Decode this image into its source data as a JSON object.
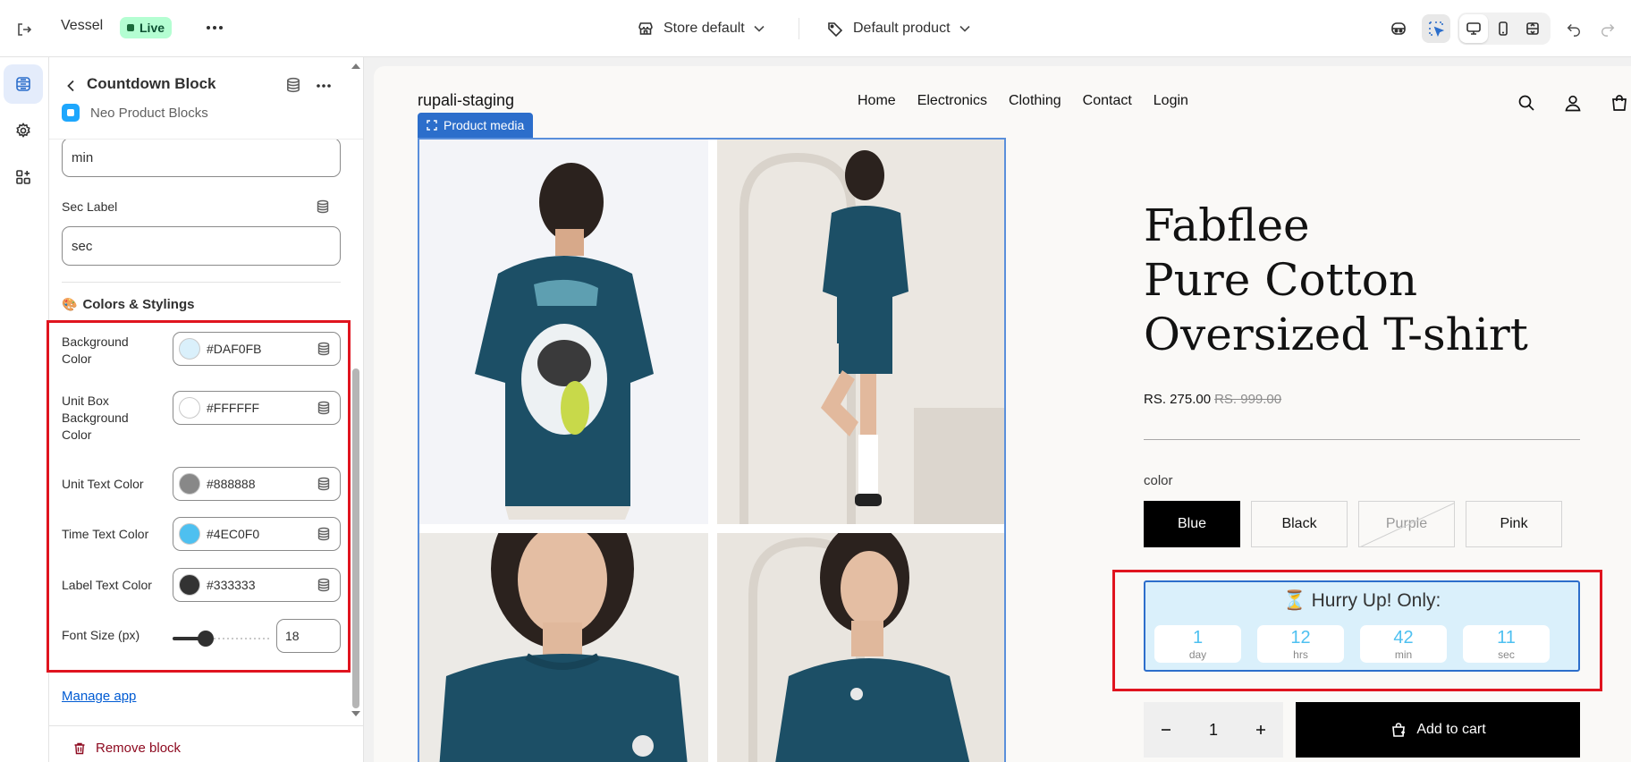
{
  "topbar": {
    "store_name": "Vessel",
    "status": "Live",
    "store_selector": "Store default",
    "template_selector": "Default product"
  },
  "sidebar": {
    "title": "Countdown Block",
    "app_name": "Neo Product Blocks",
    "min_value": "min",
    "sec_label": "Sec Label",
    "sec_value": "sec",
    "section_title": "Colors & Stylings",
    "colors": [
      {
        "label_lines": [
          "Background",
          "Color"
        ],
        "value": "#DAF0FB"
      },
      {
        "label_lines": [
          "Unit Box",
          "Background",
          "Color"
        ],
        "value": "#FFFFFF"
      },
      {
        "label_lines": [
          "Unit Text Color"
        ],
        "value": "#888888"
      },
      {
        "label_lines": [
          "Time Text Color"
        ],
        "value": "#4EC0F0"
      },
      {
        "label_lines": [
          "Label Text Color"
        ],
        "value": "#333333"
      }
    ],
    "font_size_label": "Font Size (px)",
    "font_size_value": "18",
    "font_size_slider_fraction": 0.33,
    "manage_app": "Manage app",
    "remove_block": "Remove block"
  },
  "preview": {
    "site_title": "rupali-staging",
    "nav": [
      "Home",
      "Electronics",
      "Clothing",
      "Contact",
      "Login"
    ],
    "product_media_tag": "Product media",
    "product_title_lines": [
      "Fabflee",
      "Pure Cotton",
      "Oversized T-shirt"
    ],
    "price": "RS. 275.00",
    "compare_price": "RS. 999.00",
    "option_label": "color",
    "variants": [
      "Blue",
      "Black",
      "Purple",
      "Pink"
    ],
    "selected_variant": "Blue",
    "unavailable_variant": "Purple",
    "countdown": {
      "heading": "⏳ Hurry Up! Only:",
      "units": [
        {
          "value": "1",
          "label": "day"
        },
        {
          "value": "12",
          "label": "hrs"
        },
        {
          "value": "42",
          "label": "min"
        },
        {
          "value": "11",
          "label": "sec"
        }
      ]
    },
    "quantity": "1",
    "add_to_cart": "Add to cart"
  },
  "colors": {
    "accent": "#2c6ecb",
    "highlight": "#e0141f",
    "live_badge": "#b4fed2",
    "tshirt": "#1c4f66"
  },
  "icons": [
    "exit-icon",
    "more-icon",
    "store-icon",
    "tag-icon",
    "chevron-down-icon",
    "inspector-icon",
    "select-icon",
    "desktop-icon",
    "mobile-icon",
    "fullwidth-icon",
    "undo-icon",
    "redo-icon",
    "sections-icon",
    "gear-icon",
    "apps-icon",
    "database-icon",
    "search-icon",
    "account-icon",
    "cart-icon",
    "trash-icon"
  ]
}
